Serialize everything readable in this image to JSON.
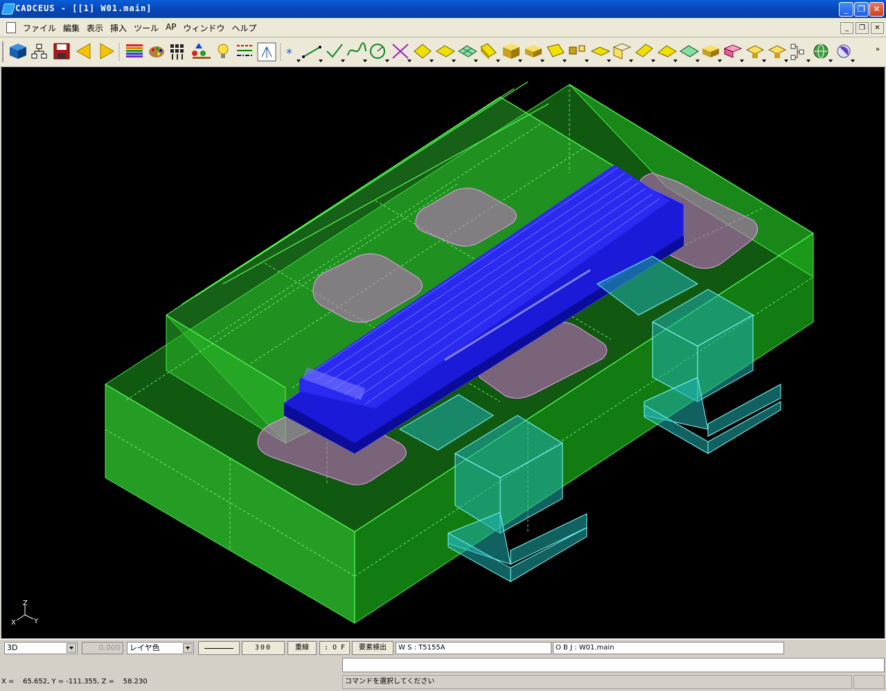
{
  "window": {
    "title": "CADCEUS - [[1] W01.main]",
    "minimize_glyph": "_",
    "restore_glyph": "❐",
    "close_glyph": "✕"
  },
  "menu": {
    "items": [
      "ファイル",
      "編集",
      "表示",
      "挿入",
      "ツール",
      "AP",
      "ウィンドウ",
      "ヘルプ"
    ]
  },
  "toolbar": {
    "icons": [
      "cube-view-icon",
      "tree-structure-icon",
      "save-icon",
      "back-arrow-icon",
      "forward-arrow-icon",
      "layer-stack-icon",
      "palette-icon",
      "grid-settings-icon",
      "shapes-icon",
      "lightbulb-icon",
      "line-type-icon",
      "snap-icon",
      "point-icon",
      "line-icon",
      "check-line-icon",
      "curve-icon",
      "circle-icon",
      "intersect-icon",
      "plane-icon",
      "surface-icon",
      "mesh-surface-icon",
      "sweep-icon",
      "box-solid-icon",
      "extrude-icon",
      "ruled-surface-icon",
      "boolean-icon",
      "offset-surface-icon",
      "shell-icon",
      "fillet-icon",
      "chamfer-icon",
      "mesh-solid-icon",
      "block-solid-icon",
      "wire-solid-icon",
      "stack-icon",
      "stack2-icon",
      "network-icon",
      "globe-icon",
      "sphere-icon"
    ]
  },
  "viewport": {
    "axis_labels": {
      "z": "Z",
      "x": "X",
      "y": "Y"
    }
  },
  "statusbar": {
    "view_mode": "3D",
    "value_field": "0.000",
    "layer_color": "レイヤ色",
    "scale": "300",
    "redraw_button": "重線",
    "snap_state": ": O F F",
    "element_detect_button": "要素検出",
    "ws_field": "W S : T5155A",
    "obj_field": "O B J : W01.main",
    "coords": "X =    65.652, Y = -111.355, Z =    58.230",
    "message": "コマンドを選択してください"
  }
}
